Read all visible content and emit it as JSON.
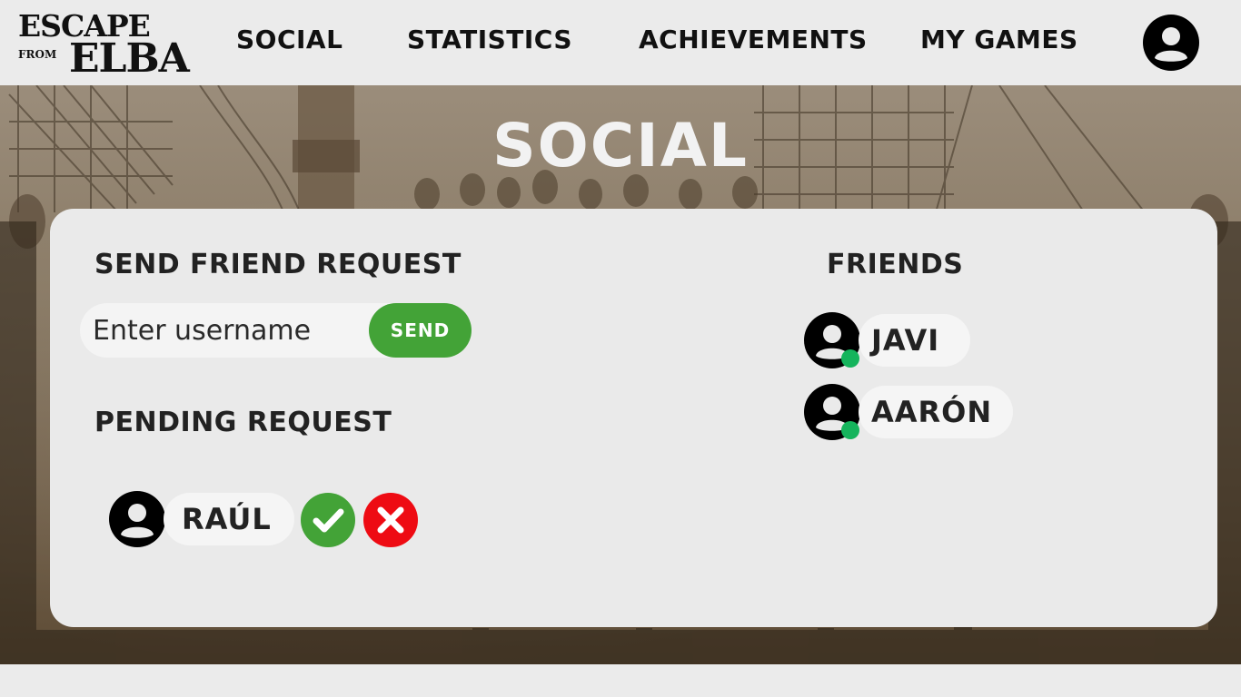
{
  "brand": {
    "logo_line1": "ESCAPE",
    "logo_from": "FROM",
    "logo_line2": "ELBA"
  },
  "nav": {
    "items": [
      {
        "label": "SOCIAL"
      },
      {
        "label": "STATISTICS"
      },
      {
        "label": "ACHIEVEMENTS"
      },
      {
        "label": "MY GAMES"
      }
    ],
    "profile_icon": "user-circle-icon"
  },
  "page": {
    "title": "SOCIAL"
  },
  "send_request": {
    "heading": "SEND FRIEND REQUEST",
    "input_value": "",
    "placeholder": "Enter username",
    "button_label": "SEND"
  },
  "pending": {
    "heading": "PENDING REQUEST",
    "requests": [
      {
        "name": "RAÚL",
        "accept_icon": "check-icon",
        "reject_icon": "close-icon"
      }
    ]
  },
  "friends": {
    "heading": "FRIENDS",
    "list": [
      {
        "name": "JAVI",
        "status": "online"
      },
      {
        "name": "AARÓN",
        "status": "online"
      }
    ]
  },
  "colors": {
    "accent_green": "#43a337",
    "reject_red": "#ee0b13",
    "online_green": "#15b45c",
    "panel_bg": "#eaeaea",
    "text_dark": "#222222"
  }
}
